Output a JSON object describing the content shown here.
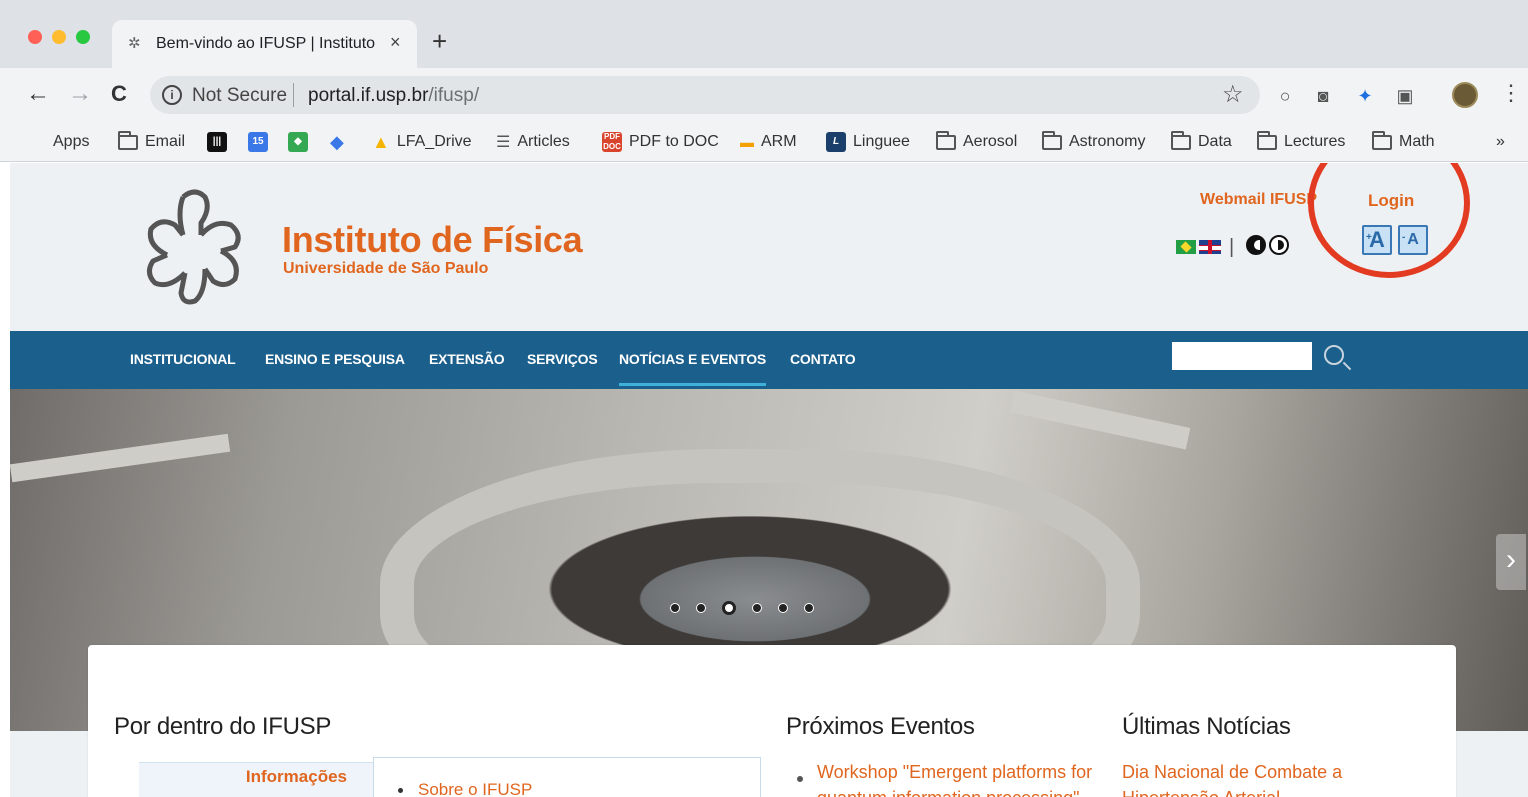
{
  "browser": {
    "tab_title": "Bem-vindo ao IFUSP | Instituto",
    "tab_close": "×",
    "new_tab": "+",
    "back": "←",
    "forward": "→",
    "reload": "C",
    "security_label": "Not Secure",
    "url_host": "portal.if.usp.br",
    "url_path": "/ifusp/",
    "star": "☆",
    "menu": "⋮"
  },
  "bookmarks": [
    {
      "label": "Apps",
      "icon": "apps-grid-icon"
    },
    {
      "label": "Email",
      "icon": "folder-icon"
    },
    {
      "label": "",
      "icon": "app-icon"
    },
    {
      "label": "",
      "icon": "calendar-icon"
    },
    {
      "label": "",
      "icon": "maps-icon"
    },
    {
      "label": "",
      "icon": "diamond-icon"
    },
    {
      "label": "LFA_Drive",
      "icon": "drive-icon"
    },
    {
      "label": "Articles",
      "icon": "stack-icon"
    },
    {
      "label": "PDF to DOC",
      "icon": "pdf-icon"
    },
    {
      "label": "ARM",
      "icon": "arm-icon"
    },
    {
      "label": "Linguee",
      "icon": "linguee-icon"
    },
    {
      "label": "Aerosol",
      "icon": "folder-icon"
    },
    {
      "label": "Astronomy",
      "icon": "folder-icon"
    },
    {
      "label": "Data",
      "icon": "folder-icon"
    },
    {
      "label": "Lectures",
      "icon": "folder-icon"
    },
    {
      "label": "Math",
      "icon": "folder-icon"
    },
    {
      "label": "»",
      "icon": "overflow-chevron-icon"
    }
  ],
  "header": {
    "title": "Instituto de Física",
    "subtitle": "Universidade de São Paulo",
    "webmail": "Webmail IFUSP",
    "login": "Login",
    "lang_separator": "|",
    "font_increase": "A",
    "font_decrease": "A",
    "font_increase_sign": "+",
    "font_decrease_sign": "-"
  },
  "nav": {
    "items": [
      "INSTITUCIONAL",
      "ENSINO E PESQUISA",
      "EXTENSÃO",
      "SERVIÇOS",
      "NOTÍCIAS E EVENTOS",
      "CONTATO"
    ],
    "active": "NOTÍCIAS E EVENTOS"
  },
  "hero": {
    "slides": 6,
    "active_slide": 3,
    "next": "›"
  },
  "sections": {
    "inside": {
      "title": "Por dentro do IFUSP",
      "tab": "Informações",
      "link": "Sobre o IFUSP"
    },
    "events": {
      "title": "Próximos Eventos",
      "item": "Workshop \"Emergent platforms for quantum information processing\""
    },
    "news": {
      "title": "Últimas Notícias",
      "item": "Dia Nacional de Combate a Hipertensão Arterial"
    }
  },
  "colors": {
    "accent": "#e0661f",
    "navbar": "#1b5f8c",
    "highlight": "#e23b22"
  }
}
